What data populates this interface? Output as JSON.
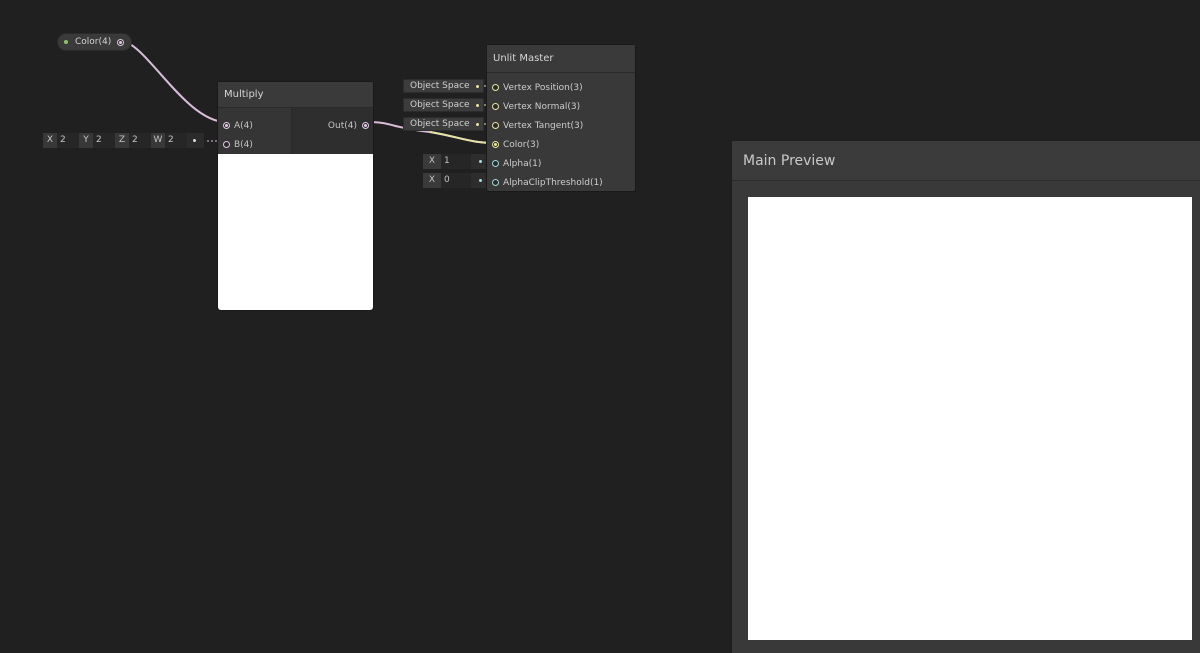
{
  "property_node": {
    "label": "Color(4)"
  },
  "vector4_input": {
    "cells": [
      {
        "axis": "X",
        "value": "2"
      },
      {
        "axis": "Y",
        "value": "2"
      },
      {
        "axis": "Z",
        "value": "2"
      },
      {
        "axis": "W",
        "value": "2"
      }
    ]
  },
  "multiply_node": {
    "title": "Multiply",
    "inputs": [
      "A(4)",
      "B(4)"
    ],
    "outputs": [
      "Out(4)"
    ]
  },
  "space_fields": [
    "Object Space",
    "Object Space",
    "Object Space"
  ],
  "alpha_input": {
    "axis": "X",
    "value": "1"
  },
  "clip_input": {
    "axis": "X",
    "value": "0"
  },
  "master_node": {
    "title": "Unlit Master",
    "ports": [
      "Vertex Position(3)",
      "Vertex Normal(3)",
      "Vertex Tangent(3)",
      "Color(3)",
      "Alpha(1)",
      "AlphaClipThreshold(1)"
    ]
  },
  "main_preview": {
    "title": "Main Preview"
  },
  "colors": {
    "background": "#202020",
    "vector4_wire": "#d8bcd8",
    "vector3_wire": "#e6e2a6",
    "vector1_wire": "#a7dde0"
  }
}
